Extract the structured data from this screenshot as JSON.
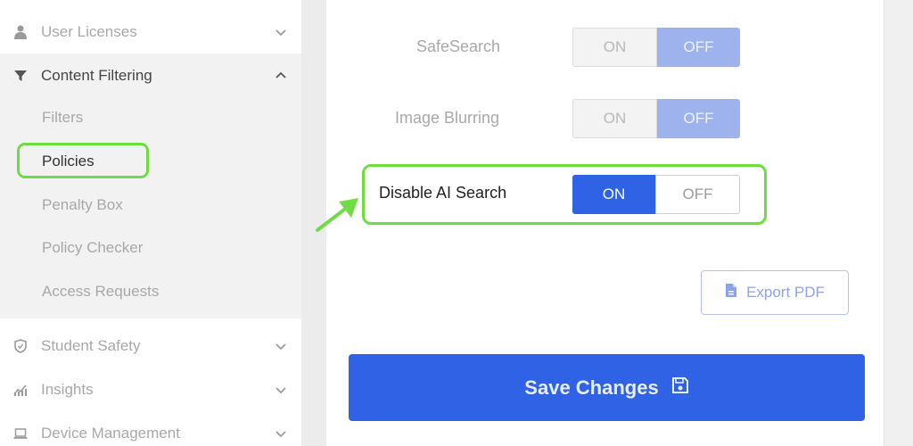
{
  "sidebar": {
    "items": [
      {
        "label": "User Licenses",
        "icon": "user-icon"
      },
      {
        "label": "Content Filtering",
        "icon": "filter-funnel-icon"
      },
      {
        "label": "Student Safety",
        "icon": "shield-icon"
      },
      {
        "label": "Insights",
        "icon": "chart-icon"
      },
      {
        "label": "Device Management",
        "icon": "laptop-icon"
      }
    ],
    "submenu": [
      {
        "label": "Filters"
      },
      {
        "label": "Policies"
      },
      {
        "label": "Penalty Box"
      },
      {
        "label": "Policy Checker"
      },
      {
        "label": "Access Requests"
      }
    ]
  },
  "settings": {
    "safesearch": {
      "label": "SafeSearch",
      "on": "ON",
      "off": "OFF",
      "state": "OFF"
    },
    "image_blurring": {
      "label": "Image Blurring",
      "on": "ON",
      "off": "OFF",
      "state": "OFF"
    },
    "disable_ai_search": {
      "label": "Disable AI Search",
      "on": "ON",
      "off": "OFF",
      "state": "ON"
    }
  },
  "buttons": {
    "export_pdf": "Export PDF",
    "save_changes": "Save Changes"
  },
  "colors": {
    "accent": "#2f62e4",
    "highlight": "#6fdc43"
  }
}
